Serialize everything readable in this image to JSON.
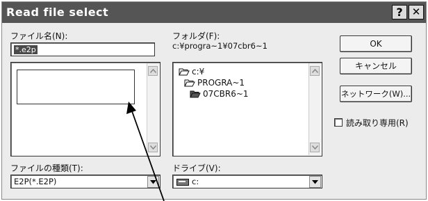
{
  "window": {
    "title": "Read file select",
    "help_btn": "?",
    "close_btn": "✕"
  },
  "filename": {
    "label": "ファイル名(N):",
    "value": "*.e2p",
    "list_items": []
  },
  "folder": {
    "label": "フォルダ(F):",
    "path": "c:¥progra~1¥07cbr6~1",
    "tree": [
      {
        "label": "c:¥",
        "icon": "open-folder-icon"
      },
      {
        "label": "PROGRA~1",
        "icon": "open-folder-icon"
      },
      {
        "label": "07CBR6~1",
        "icon": "open-folder-filled-icon"
      }
    ]
  },
  "buttons": {
    "ok": "OK",
    "cancel": "キャンセル",
    "network": "ネットワーク(W)..."
  },
  "readonly": {
    "label": "読み取り専用(R)",
    "checked": false
  },
  "filetype": {
    "label": "ファイルの種類(T):",
    "value": "E2P(*.E2P)"
  },
  "drive": {
    "label": "ドライブ(V):",
    "value": "c:",
    "icon": "drive-icon"
  }
}
